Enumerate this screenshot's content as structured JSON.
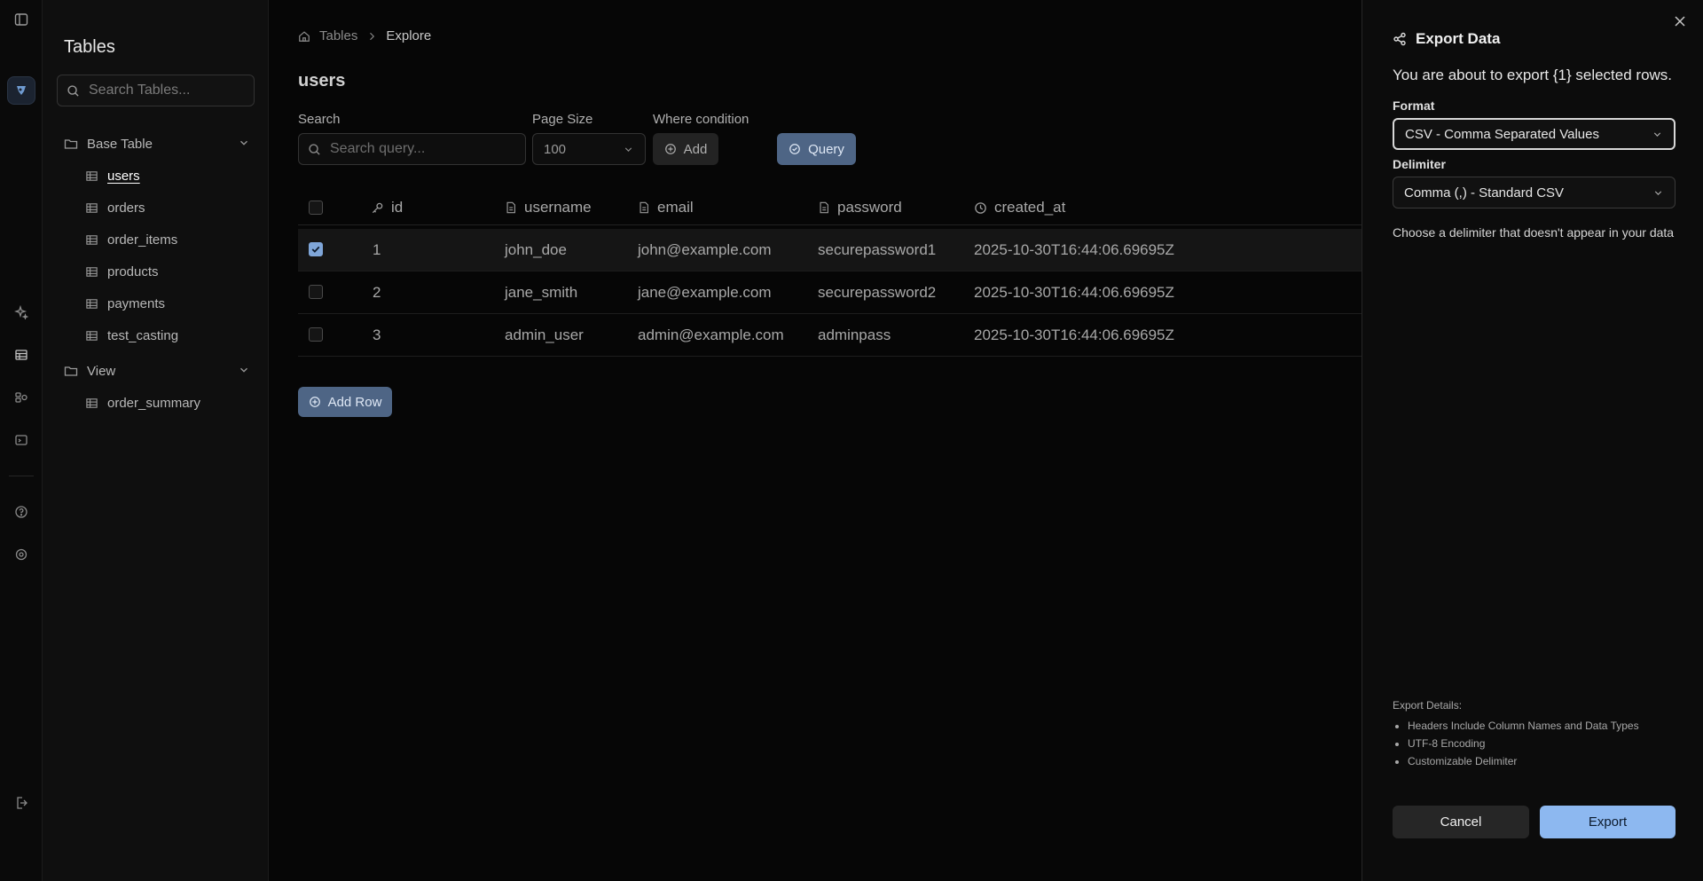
{
  "sidebar": {
    "title": "Tables",
    "search_placeholder": "Search Tables...",
    "groups": [
      {
        "label": "Base Table",
        "items": [
          "users",
          "orders",
          "order_items",
          "products",
          "payments",
          "test_casting"
        ]
      },
      {
        "label": "View",
        "items": [
          "order_summary"
        ]
      }
    ],
    "active_item": "users"
  },
  "breadcrumb": {
    "home": "Tables",
    "current": "Explore"
  },
  "page": {
    "title": "users"
  },
  "filters": {
    "search_label": "Search",
    "search_placeholder": "Search query...",
    "page_size_label": "Page Size",
    "page_size_value": "100",
    "where_label": "Where condition",
    "add_label": "Add",
    "query_label": "Query"
  },
  "table": {
    "columns": [
      "id",
      "username",
      "email",
      "password",
      "created_at"
    ],
    "rows": [
      {
        "selected": true,
        "id": "1",
        "username": "john_doe",
        "email": "john@example.com",
        "password": "securepassword1",
        "created_at": "2025-10-30T16:44:06.69695Z"
      },
      {
        "selected": false,
        "id": "2",
        "username": "jane_smith",
        "email": "jane@example.com",
        "password": "securepassword2",
        "created_at": "2025-10-30T16:44:06.69695Z"
      },
      {
        "selected": false,
        "id": "3",
        "username": "admin_user",
        "email": "admin@example.com",
        "password": "adminpass",
        "created_at": "2025-10-30T16:44:06.69695Z"
      }
    ],
    "add_row_label": "Add Row"
  },
  "export_panel": {
    "title": "Export Data",
    "description": "You are about to export {1} selected rows.",
    "format_label": "Format",
    "format_value": "CSV - Comma Separated Values",
    "delimiter_label": "Delimiter",
    "delimiter_value": "Comma (,) - Standard CSV",
    "delimiter_hint": "Choose a delimiter that doesn't appear in your data",
    "details_title": "Export Details:",
    "details": [
      "Headers Include Column Names and Data Types",
      "UTF-8 Encoding",
      "Customizable Delimiter"
    ],
    "cancel_label": "Cancel",
    "export_label": "Export"
  },
  "colors": {
    "accent": "#8db8f0",
    "button_primary": "#4e6585",
    "panel_bg": "#0c0c0c"
  }
}
